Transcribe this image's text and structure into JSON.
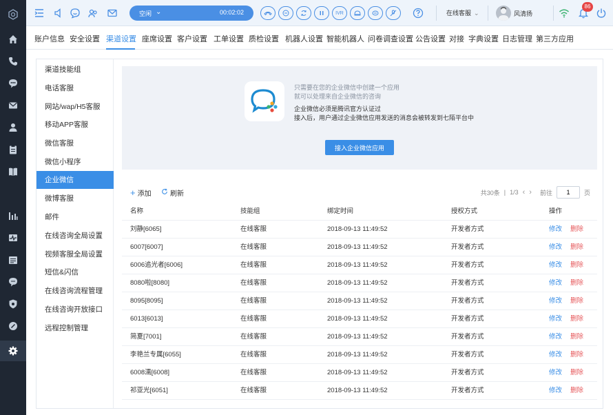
{
  "topbar": {
    "status": "空闲",
    "timer": "00:02:02",
    "call_icons": [
      "phone-hangup-icon",
      "hold-icon",
      "transfer-icon",
      "pause-icon",
      "ivr",
      "consult-icon",
      "chat-icon",
      "mute-icon"
    ],
    "ivr_label": "IVR",
    "agent_group": "在线客服",
    "user_name": "风清扬",
    "notification_count": "86"
  },
  "nav": {
    "tabs": [
      "账户信息",
      "安全设置",
      "渠道设置",
      "座席设置",
      "客户设置",
      "工单设置",
      "质检设置",
      "机器人设置",
      "智能机器人",
      "问卷调查设置",
      "公告设置",
      "对接",
      "字典设置",
      "日志管理",
      "第三方应用"
    ],
    "active_index": 2
  },
  "subnav": {
    "items": [
      "渠道技能组",
      "电话客服",
      "网站/wap/H5客服",
      "移动APP客服",
      "微信客服",
      "微信小程序",
      "企业微信",
      "微博客服",
      "邮件",
      "在线咨询全局设置",
      "视频客服全局设置",
      "短信&闪信",
      "在线咨询流程管理",
      "在线咨询开放接口",
      "远程控制管理"
    ],
    "active_index": 6
  },
  "banner": {
    "line1": "只需要在您的企业微信中创建一个应用",
    "line2": "就可以处理来自企业微信的咨询",
    "line3": "企业微信必须是腾讯官方认证过",
    "line4": "接入后，用户通过企业微信应用发送的消息会被转发到七陌平台中",
    "button": "接入企业微信应用"
  },
  "toolbar": {
    "add": "添加",
    "refresh": "刷新",
    "total": "共30条",
    "page_info": "1/3",
    "goto": "前往",
    "page_value": "1",
    "page_suffix": "页"
  },
  "table": {
    "headers": [
      "名称",
      "技能组",
      "绑定时间",
      "授权方式",
      "操作"
    ],
    "edit_label": "修改",
    "delete_label": "删除",
    "rows": [
      [
        "刘静[6065]",
        "在线客服",
        "2018-09-13 11:49:52",
        "开发者方式"
      ],
      [
        "6007[6007]",
        "在线客服",
        "2018-09-13 11:49:52",
        "开发者方式"
      ],
      [
        "6006追光者[6006]",
        "在线客服",
        "2018-09-13 11:49:52",
        "开发者方式"
      ],
      [
        "8080啦[8080]",
        "在线客服",
        "2018-09-13 11:49:52",
        "开发者方式"
      ],
      [
        "8095[8095]",
        "在线客服",
        "2018-09-13 11:49:52",
        "开发者方式"
      ],
      [
        "6013[6013]",
        "在线客服",
        "2018-09-13 11:49:52",
        "开发者方式"
      ],
      [
        "简夏[7001]",
        "在线客服",
        "2018-09-13 11:49:52",
        "开发者方式"
      ],
      [
        "李艳兰专属[6055]",
        "在线客服",
        "2018-09-13 11:49:52",
        "开发者方式"
      ],
      [
        "6008濡[6008]",
        "在线客服",
        "2018-09-13 11:49:52",
        "开发者方式"
      ],
      [
        "祁亚光[6051]",
        "在线客服",
        "2018-09-13 11:49:52",
        "开发者方式"
      ]
    ]
  },
  "colors": {
    "accent": "#3a8ee6",
    "rail_bg": "#1f2733",
    "danger": "#e6585b"
  }
}
